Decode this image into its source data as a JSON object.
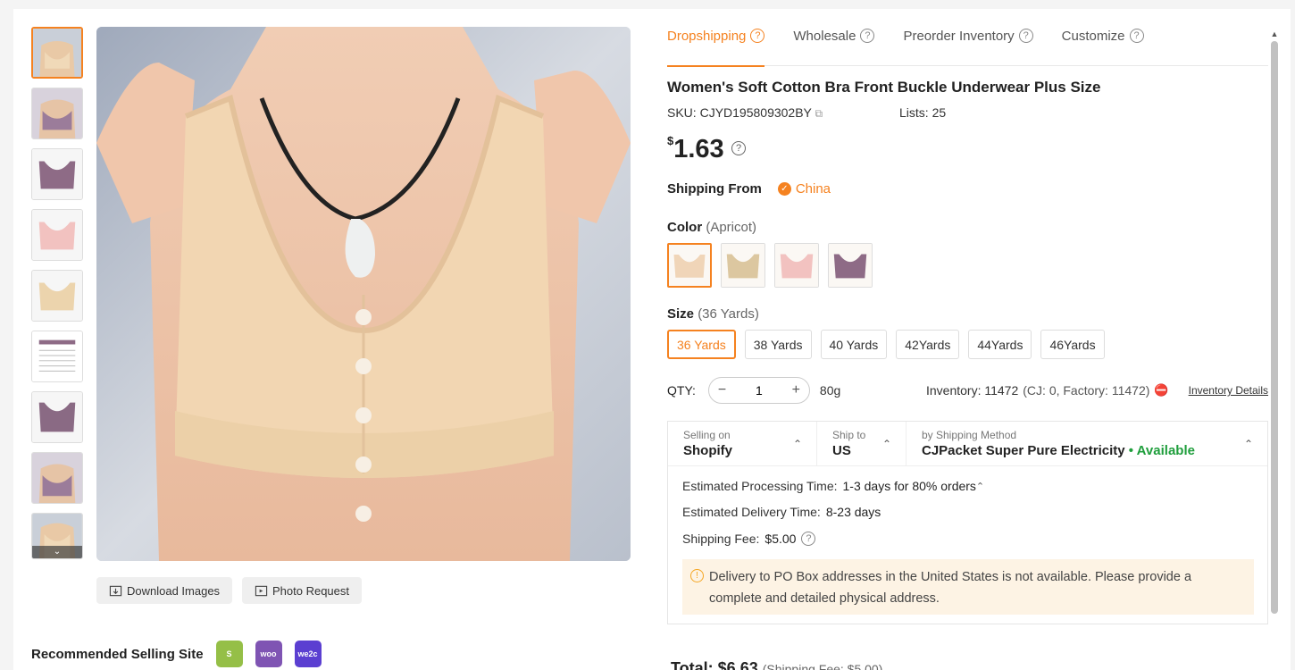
{
  "thumbnails": [
    "thumb-1",
    "thumb-2",
    "thumb-3",
    "thumb-4",
    "thumb-5",
    "thumb-6",
    "thumb-7",
    "thumb-8",
    "thumb-9"
  ],
  "image_actions": {
    "download": "Download Images",
    "photo_request": "Photo Request"
  },
  "recommended": {
    "label": "Recommended Selling Site",
    "sites": [
      "shopify-icon",
      "woo",
      "we2c"
    ]
  },
  "tabs": [
    {
      "label": "Dropshipping",
      "active": true
    },
    {
      "label": "Wholesale"
    },
    {
      "label": "Preorder Inventory"
    },
    {
      "label": "Customize"
    }
  ],
  "product": {
    "title": "Women's Soft Cotton Bra Front Buckle Underwear Plus Size",
    "sku_label": "SKU:",
    "sku": "CJYD195809302BY",
    "lists_label": "Lists:",
    "lists": "25",
    "currency": "$",
    "price": "1.63"
  },
  "shipping_from": {
    "label": "Shipping From",
    "value": "China"
  },
  "color": {
    "label": "Color",
    "selected": "(Apricot)",
    "swatches": [
      "#f0d5b8",
      "#dcc7a0",
      "#f2c2c0",
      "#8e6b86"
    ]
  },
  "size": {
    "label": "Size",
    "selected": "(36 Yards)",
    "options": [
      "36 Yards",
      "38 Yards",
      "40 Yards",
      "42Yards",
      "44Yards",
      "46Yards"
    ]
  },
  "qty": {
    "label": "QTY:",
    "value": "1",
    "weight": "80g",
    "inventory": "Inventory: 11472",
    "inventory_breakdown": "(CJ: 0, Factory: 11472)",
    "inventory_details": "Inventory Details"
  },
  "ship": {
    "selling_on_label": "Selling on",
    "selling_on": "Shopify",
    "ship_to_label": "Ship to",
    "ship_to": "US",
    "method_label": "by Shipping Method",
    "method": "CJPacket Super Pure Electricity",
    "availability": "• Available",
    "processing_label": "Estimated Processing Time:",
    "processing": "1-3 days for 80% orders",
    "delivery_label": "Estimated Delivery Time:",
    "delivery": "8-23 days",
    "fee_label": "Shipping Fee:",
    "fee": "$5.00",
    "warning": "Delivery to PO Box addresses in the United States is not available. Please provide a complete and detailed physical address."
  },
  "total": {
    "label": "Total:",
    "value": "$6.63",
    "shipping_note": "(Shipping Fee: $5.00)"
  },
  "colors": {
    "accent": "#f58220",
    "available": "#1f9e3c",
    "warning_bg": "#fdf3e4"
  }
}
